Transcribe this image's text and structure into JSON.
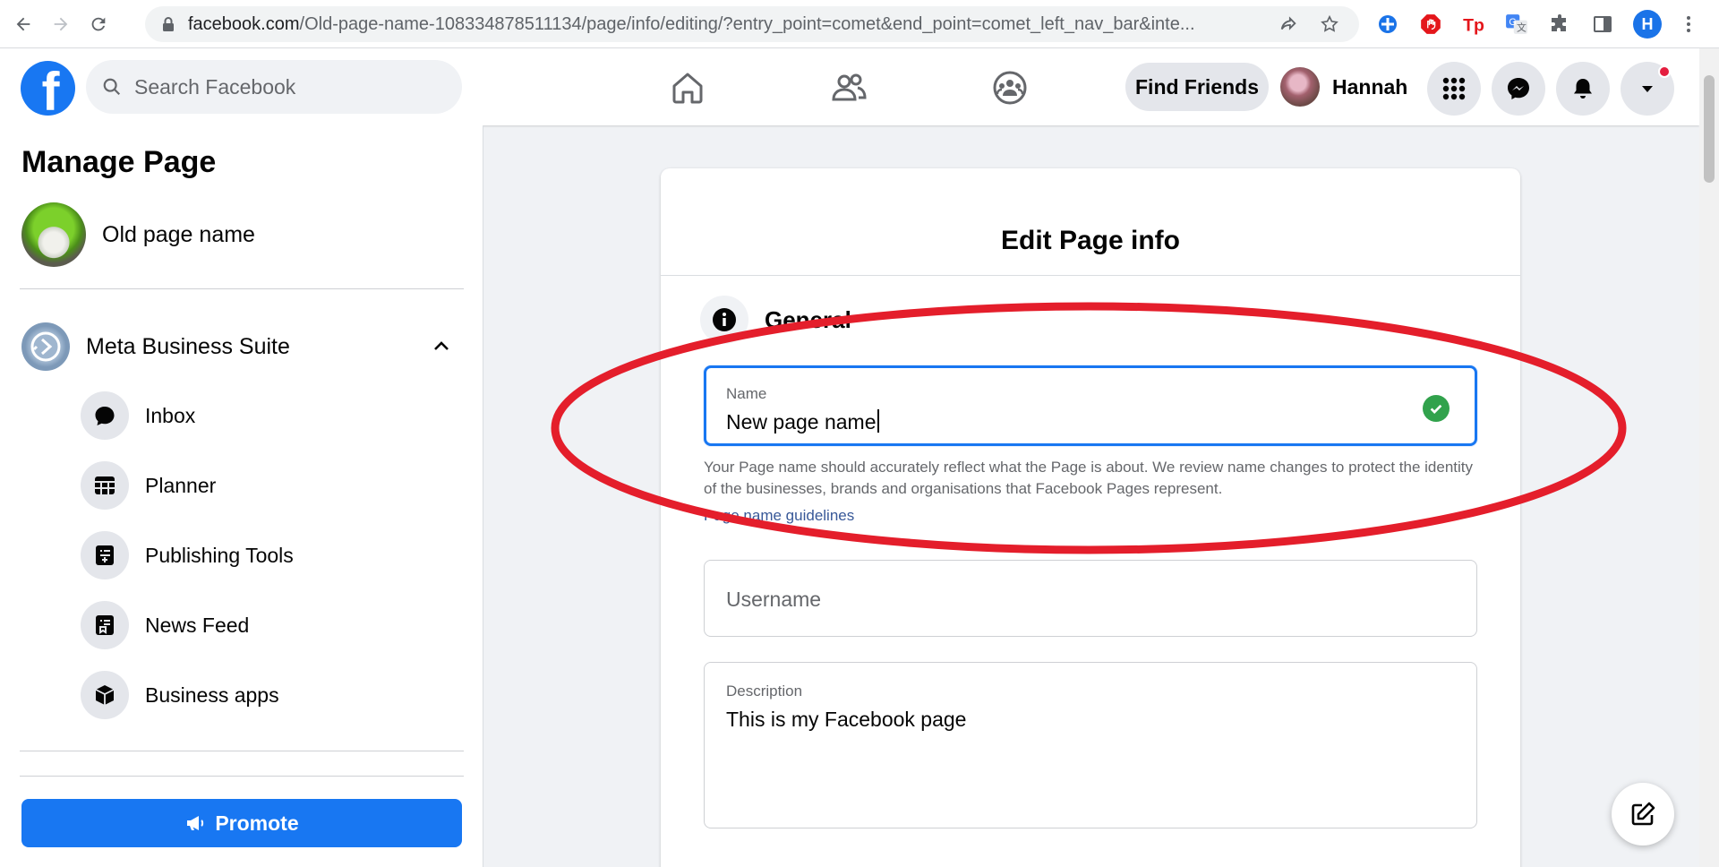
{
  "browser": {
    "url_host": "facebook.com",
    "url_path": "/Old-page-name-108334878511134/page/info/editing/?entry_point=comet&end_point=comet_left_nav_bar&inte...",
    "profile_initial": "H"
  },
  "header": {
    "search_placeholder": "Search Facebook",
    "find_friends_label": "Find Friends",
    "profile_name": "Hannah",
    "logo_letter": "f"
  },
  "sidebar": {
    "title": "Manage Page",
    "page_name": "Old page name",
    "suite_label": "Meta Business Suite",
    "items": [
      {
        "label": "Inbox",
        "icon": "chat-bubble-icon"
      },
      {
        "label": "Planner",
        "icon": "calendar-grid-icon"
      },
      {
        "label": "Publishing Tools",
        "icon": "publishing-tools-icon"
      },
      {
        "label": "News Feed",
        "icon": "news-feed-icon"
      },
      {
        "label": "Business apps",
        "icon": "cube-icon"
      }
    ],
    "promote_label": "Promote"
  },
  "main": {
    "title": "Edit Page info",
    "section_title": "General",
    "name_field": {
      "label": "Name",
      "value": "New page name"
    },
    "help_text": "Your Page name should accurately reflect what the Page is about. We review name changes to protect the identity of the businesses, brands and organisations that Facebook Pages represent.",
    "help_link": "Page name guidelines",
    "username_field": {
      "placeholder": "Username"
    },
    "description_field": {
      "label": "Description",
      "value": "This is my Facebook page"
    }
  },
  "colors": {
    "brand": "#1877f2",
    "success": "#31a24c",
    "annotation": "#e41e2b"
  }
}
